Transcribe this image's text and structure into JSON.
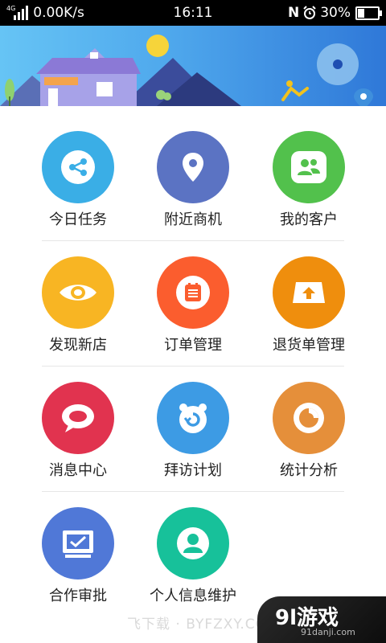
{
  "status_bar": {
    "network_tag": "4G",
    "speed": "0.00K/s",
    "time": "16:11",
    "nfc": "N",
    "battery": "30%",
    "battery_level": 0.3
  },
  "menu": [
    {
      "label": "今日任务",
      "icon": "share-icon",
      "color": "#3aaee6"
    },
    {
      "label": "附近商机",
      "icon": "location-pin-icon",
      "color": "#5b73c3"
    },
    {
      "label": "我的客户",
      "icon": "customers-icon",
      "color": "#52c14c"
    },
    {
      "label": "发现新店",
      "icon": "eye-icon",
      "color": "#f8b523"
    },
    {
      "label": "订单管理",
      "icon": "order-list-icon",
      "color": "#fb5d2e"
    },
    {
      "label": "退货单管理",
      "icon": "return-box-icon",
      "color": "#ef8e0d"
    },
    {
      "label": "消息中心",
      "icon": "chat-bubble-icon",
      "color": "#e1334f"
    },
    {
      "label": "拜访计划",
      "icon": "visit-plan-icon",
      "color": "#3d9be4"
    },
    {
      "label": "统计分析",
      "icon": "pie-chart-icon",
      "color": "#e58f3a"
    },
    {
      "label": "合作审批",
      "icon": "approval-check-icon",
      "color": "#5078d7"
    },
    {
      "label": "个人信息维护",
      "icon": "profile-icon",
      "color": "#17c19a"
    }
  ],
  "watermark": {
    "site_text": "飞下载 · BYFZXY.COM",
    "logo_text": "9l游戏",
    "logo_sub": "91danji.com"
  }
}
